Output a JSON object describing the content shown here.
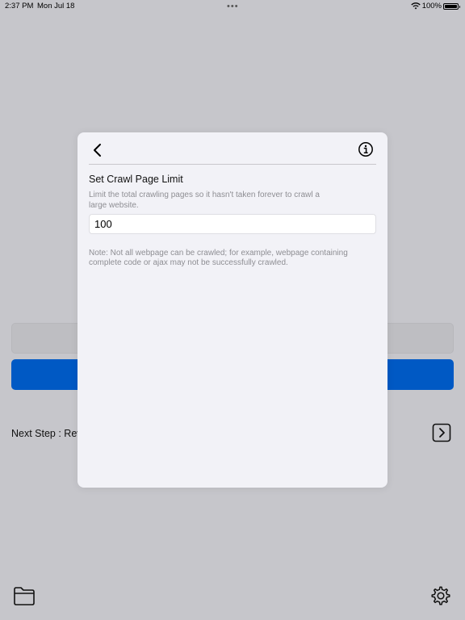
{
  "status_bar": {
    "time": "2:37 PM",
    "date": "Mon Jul 18",
    "dots": "•••",
    "battery": "100%"
  },
  "background": {
    "next_step_label": "Next Step : Rev"
  },
  "modal": {
    "section_title": "Set Crawl Page Limit",
    "section_description": "Limit the total crawling pages so it hasn't taken forever to crawl a large website.",
    "page_limit_value": "100",
    "note": "Note: Not all webpage can be crawled; for example, webpage containing complete code or ajax may not be successfully crawled."
  },
  "colors": {
    "accent_blue": "#0059c4",
    "modal_background": "#f2f2f7",
    "secondary_text": "#8e8e93",
    "screen_dim": "#c6c6cb"
  }
}
